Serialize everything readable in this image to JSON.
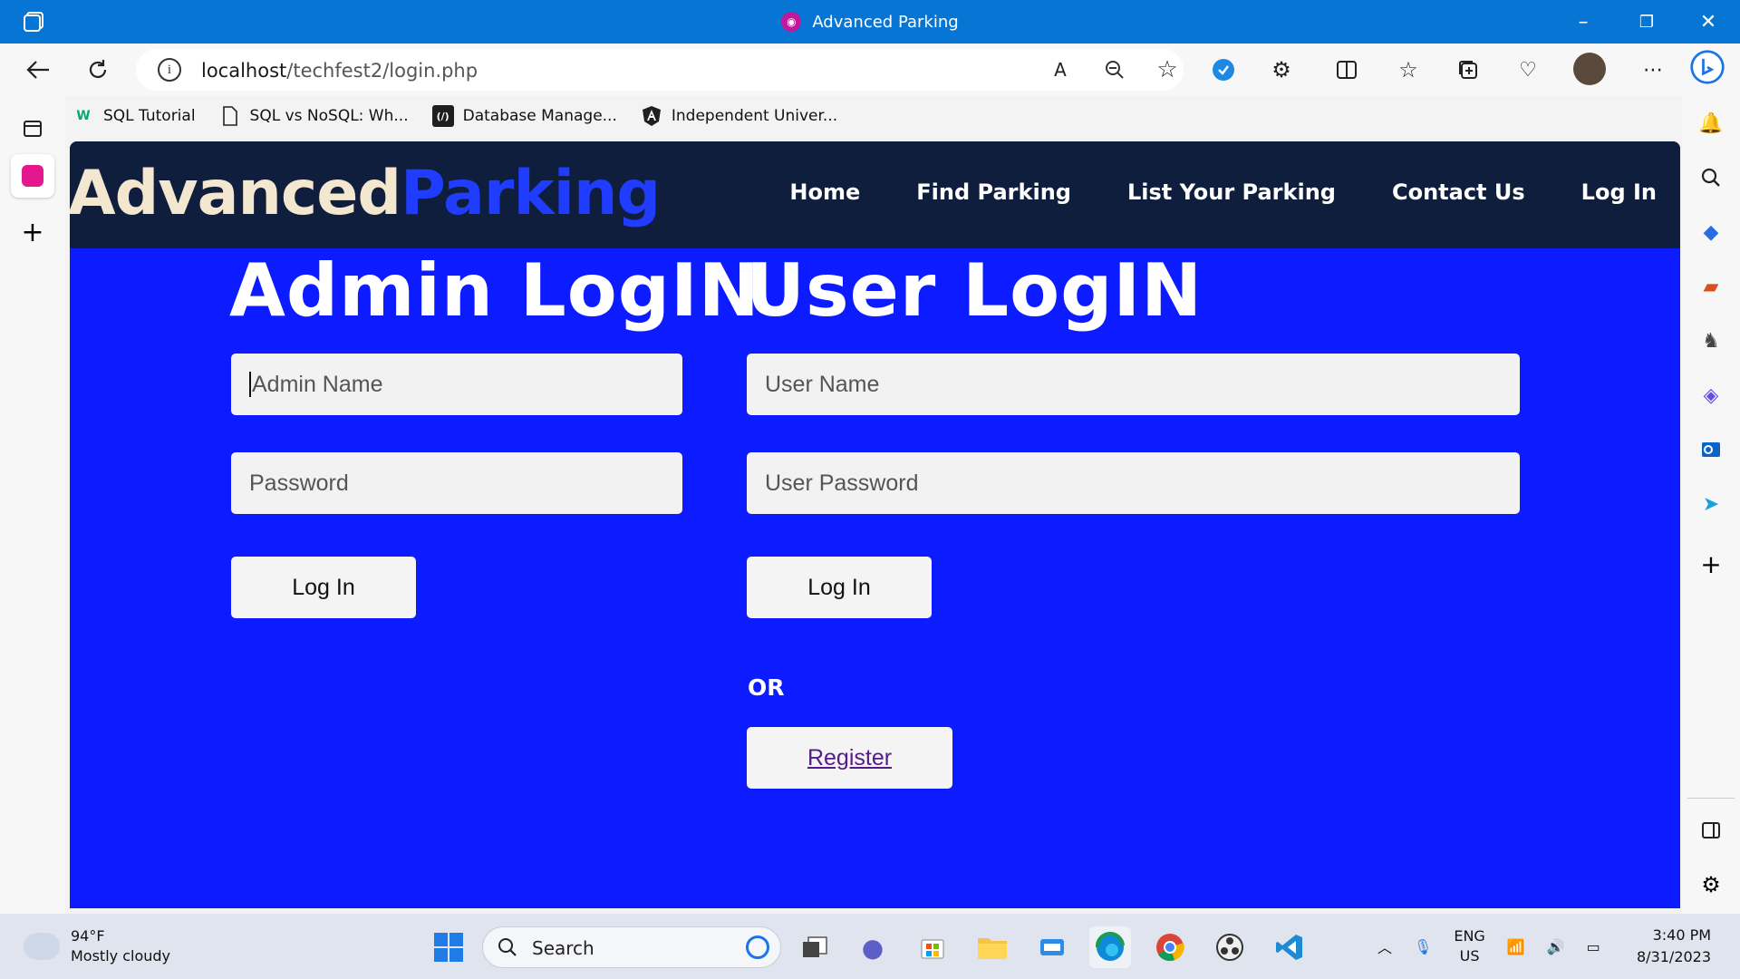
{
  "window": {
    "title": "Advanced Parking",
    "controls": [
      "–",
      "❐",
      "✕"
    ]
  },
  "toolbar": {
    "url_host": "localhost",
    "url_path": "/techfest2/login.php"
  },
  "bookmarks": [
    {
      "label": "SQL Tutorial",
      "icon": "w3schools-icon"
    },
    {
      "label": "SQL vs NoSQL: Wh...",
      "icon": "page-icon"
    },
    {
      "label": "Database Manage...",
      "icon": "codecademy-icon"
    },
    {
      "label": "Independent Univer...",
      "icon": "angular-icon"
    }
  ],
  "site": {
    "logo_part1": "Advanced",
    "logo_part2": "Parking",
    "nav": [
      "Home",
      "Find Parking",
      "List Your Parking",
      "Contact Us",
      "Log In"
    ]
  },
  "admin": {
    "heading": "Admin LogIN",
    "name_placeholder": "Admin Name",
    "password_placeholder": "Password",
    "button": "Log In"
  },
  "user": {
    "heading": "User LogIN",
    "name_placeholder": "User Name",
    "password_placeholder": "User Password",
    "button": "Log In",
    "or": "OR",
    "register": "Register"
  },
  "taskbar": {
    "temperature": "94°F",
    "weather": "Mostly cloudy",
    "search": "Search",
    "lang1": "ENG",
    "lang2": "US",
    "time": "3:40 PM",
    "date": "8/31/2023"
  },
  "colors": {
    "page_bg": "#0c1bff",
    "navbar_bg": "#0f1e3c",
    "logo_accent": "#1f3cff",
    "titlebar": "#0675d3"
  }
}
